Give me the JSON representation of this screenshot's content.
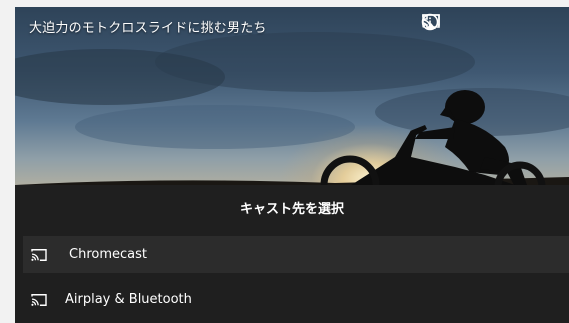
{
  "video": {
    "title": "大迫力のモトクロスライドに挑む男たち"
  },
  "controls": [
    {
      "name": "info-icon"
    },
    {
      "name": "airplay-icon"
    },
    {
      "name": "cast-icon"
    },
    {
      "name": "fullscreen-exit-icon"
    }
  ],
  "cast_sheet": {
    "title": "キャスト先を選択",
    "devices": [
      {
        "label": "Chromecast",
        "icon": "cast-icon",
        "selected": true
      },
      {
        "label": "Airplay & Bluetooth",
        "icon": "cast-icon",
        "selected": false
      }
    ]
  },
  "colors": {
    "sheet_background": "#1f1f1f",
    "selected_row": "#2c2c2c",
    "text": "#ffffff"
  }
}
